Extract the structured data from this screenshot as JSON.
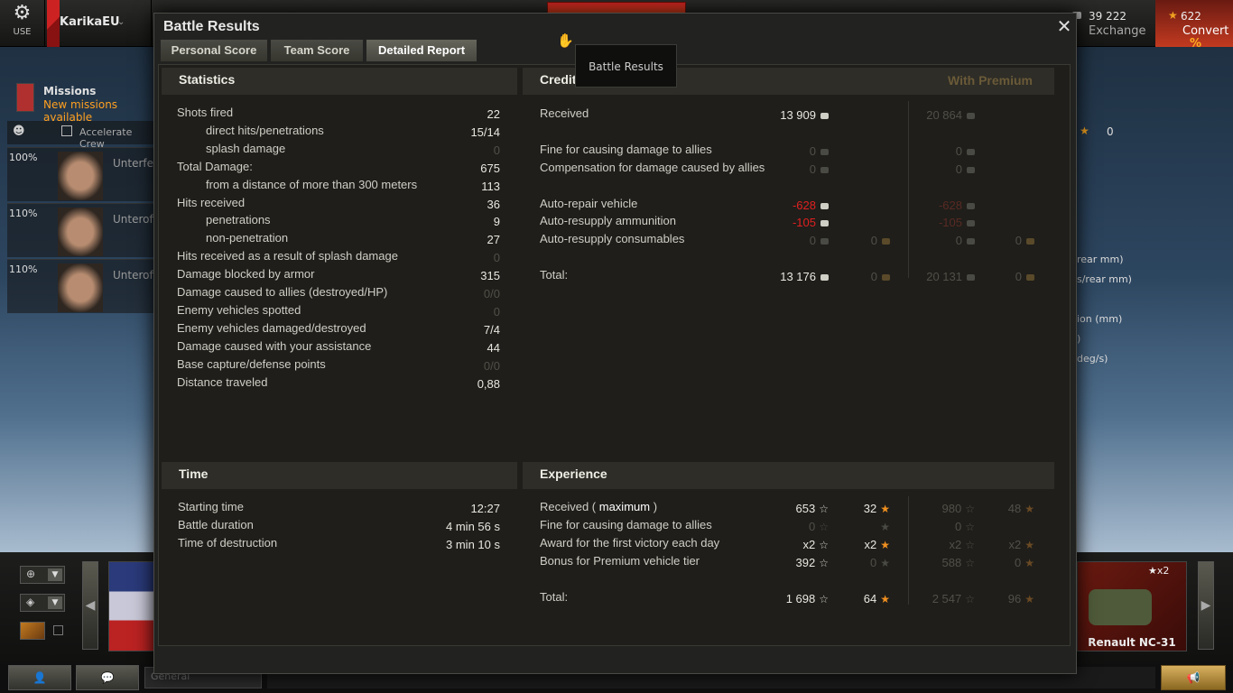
{
  "topbar": {
    "settings_label": "USE",
    "player_name": "KarikaEU",
    "credits": "39 222",
    "exchange": "Exchange",
    "gold": "622",
    "convert": "Convert",
    "convert_pct": "%"
  },
  "garage": {
    "missions_title": "Missions",
    "missions_sub": "New missions available",
    "accelerate": "Accelerate Crew",
    "crew": [
      {
        "pct": "100%",
        "rank": "Unterfel"
      },
      {
        "pct": "110%",
        "rank": "Unteroff"
      },
      {
        "pct": "110%",
        "rank": "Unteroff"
      }
    ],
    "right_stats": [
      "rear mm)",
      "s/rear mm)",
      "ion (mm)",
      ")",
      "deg/s)"
    ],
    "right_gold": "0",
    "tank_name": "Renault NC-31",
    "tank_xp": "x2",
    "chat_channel": "General"
  },
  "dialog": {
    "title": "Battle Results",
    "tooltip": "Battle Results",
    "tabs": [
      "Personal Score",
      "Team Score",
      "Detailed Report"
    ],
    "active_tab": 2
  },
  "statistics": {
    "header": "Statistics",
    "rows": [
      {
        "label": "Shots fired",
        "value": "22",
        "indent": false,
        "dim": false
      },
      {
        "label": "direct hits/penetrations",
        "value": "15/14",
        "indent": true,
        "dim": false
      },
      {
        "label": "splash damage",
        "value": "0",
        "indent": true,
        "dim": true
      },
      {
        "label": "Total Damage:",
        "value": "675",
        "indent": false,
        "dim": false
      },
      {
        "label": "from a distance of more than 300 meters",
        "value": "113",
        "indent": true,
        "dim": false
      },
      {
        "label": "Hits received",
        "value": "36",
        "indent": false,
        "dim": false
      },
      {
        "label": "penetrations",
        "value": "9",
        "indent": true,
        "dim": false
      },
      {
        "label": "non-penetration",
        "value": "27",
        "indent": true,
        "dim": false
      },
      {
        "label": "Hits received as a result of splash damage",
        "value": "0",
        "indent": false,
        "dim": true
      },
      {
        "label": "Damage blocked by armor",
        "value": "315",
        "indent": false,
        "dim": false
      },
      {
        "label": "Damage caused to allies (destroyed/HP)",
        "value": "0/0",
        "indent": false,
        "dim": true
      },
      {
        "label": "Enemy vehicles spotted",
        "value": "0",
        "indent": false,
        "dim": true
      },
      {
        "label": "Enemy vehicles damaged/destroyed",
        "value": "7/4",
        "indent": false,
        "dim": false
      },
      {
        "label": "Damage caused with your assistance",
        "value": "44",
        "indent": false,
        "dim": false
      },
      {
        "label": "Base capture/defense points",
        "value": "0/0",
        "indent": false,
        "dim": true
      },
      {
        "label": "Distance traveled",
        "value": "0,88",
        "indent": false,
        "dim": false
      }
    ]
  },
  "credits": {
    "header": "Credit",
    "premium_header": "With Premium",
    "rows": [
      {
        "label": "Received",
        "c1": "13 909",
        "c2": "",
        "p1": "20 864",
        "p2": "",
        "c1dim": false,
        "c1red": false
      },
      {
        "label": "Fine for causing damage to allies",
        "c1": "0",
        "c2": "",
        "p1": "0",
        "p2": "",
        "c1dim": true,
        "c1red": false
      },
      {
        "label": "Compensation for damage caused by allies",
        "c1": "0",
        "c2": "",
        "p1": "0",
        "p2": "",
        "c1dim": true,
        "c1red": false
      },
      {
        "label": "Auto-repair vehicle",
        "c1": "-628",
        "c2": "",
        "p1": "-628",
        "p2": "",
        "c1dim": false,
        "c1red": true
      },
      {
        "label": "Auto-resupply ammunition",
        "c1": "-105",
        "c2": "",
        "p1": "-105",
        "p2": "",
        "c1dim": false,
        "c1red": true
      },
      {
        "label": "Auto-resupply consumables",
        "c1": "0",
        "c2": "0",
        "p1": "0",
        "p2": "0",
        "c1dim": true,
        "c1red": false
      },
      {
        "label": "Total:",
        "c1": "13 176",
        "c2": "0",
        "p1": "20 131",
        "p2": "0",
        "c1dim": false,
        "c1red": false
      }
    ]
  },
  "time": {
    "header": "Time",
    "rows": [
      {
        "label": "Starting time",
        "value": "12:27"
      },
      {
        "label": "Battle duration",
        "value": "4 min 56 s"
      },
      {
        "label": "Time of destruction",
        "value": "3 min 10 s"
      }
    ]
  },
  "experience": {
    "header": "Experience",
    "received_label": "Received (",
    "received_bold": "maximum",
    "received_close": ")",
    "rows": [
      {
        "label": "Received",
        "x1": "653",
        "x2": "32",
        "p1": "980",
        "p2": "48",
        "x1dim": false,
        "x2dim": false
      },
      {
        "label": "Fine for causing damage to allies",
        "x1": "0",
        "x2": "",
        "p1": "0",
        "p2": "",
        "x1dim": true,
        "x2dim": true
      },
      {
        "label": "Award for the first victory each day",
        "x1": "x2",
        "x2": "x2",
        "p1": "x2",
        "p2": "x2",
        "x1dim": false,
        "x2dim": false
      },
      {
        "label": "Bonus for Premium vehicle tier",
        "x1": "392",
        "x2": "0",
        "p1": "588",
        "p2": "0",
        "x1dim": false,
        "x2dim": true
      },
      {
        "label": "Total:",
        "x1": "1 698",
        "x2": "64",
        "p1": "2 547",
        "p2": "96",
        "x1dim": false,
        "x2dim": false
      }
    ]
  }
}
